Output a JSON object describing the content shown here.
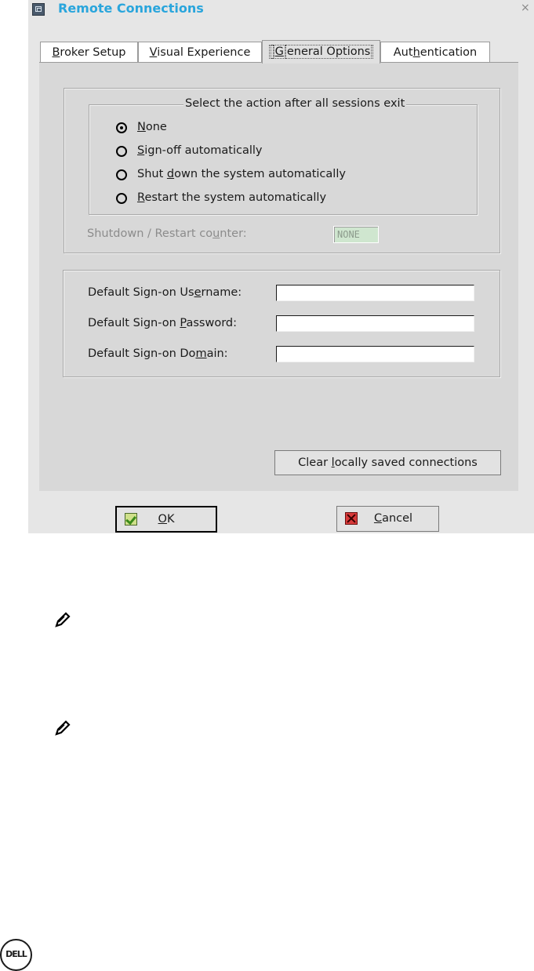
{
  "window": {
    "title": "Remote Connections",
    "close_glyph": "×"
  },
  "tabs": [
    {
      "pre": "",
      "accel": "B",
      "post": "roker Setup"
    },
    {
      "pre": "",
      "accel": "V",
      "post": "isual Experience"
    },
    {
      "pre": "",
      "accel": "G",
      "post": "eneral Options",
      "active": true
    },
    {
      "pre": "Aut",
      "accel": "h",
      "post": "entication"
    }
  ],
  "session_exit": {
    "legend": "Select the action after all sessions exit",
    "options": [
      {
        "pre": "",
        "accel": "N",
        "post": "one",
        "checked": true
      },
      {
        "pre": "",
        "accel": "S",
        "post": "ign-off automatically",
        "checked": false
      },
      {
        "pre": "Shut ",
        "accel": "d",
        "post": "own the system automatically",
        "checked": false
      },
      {
        "pre": "",
        "accel": "R",
        "post": "estart the system automatically",
        "checked": false
      }
    ],
    "counter_label_pre": "Shutdown / Restart co",
    "counter_label_accel": "u",
    "counter_label_post": "nter:",
    "counter_value": "NONE"
  },
  "sign_on": {
    "username": {
      "pre": "Default Sign-on Us",
      "accel": "e",
      "post": "rname:",
      "value": ""
    },
    "password": {
      "pre": "Default Sign-on ",
      "accel": "P",
      "post": "assword:",
      "value": ""
    },
    "domain": {
      "pre": "Default Sign-on Do",
      "accel": "m",
      "post": "ain:",
      "value": ""
    }
  },
  "clear_button": {
    "pre": "Clear ",
    "accel": "l",
    "post": "ocally saved connections"
  },
  "ok_button": {
    "pre": "",
    "accel": "O",
    "post": "K"
  },
  "cancel_button": {
    "pre": "",
    "accel": "C",
    "post": "ancel"
  },
  "logo_text": "DELL",
  "icons": {
    "app": "remote-connections-icon",
    "close": "close-icon",
    "ok": "checkmark-icon",
    "cancel": "x-icon",
    "note": "pencil-note-icon"
  },
  "colors": {
    "title": "#29a5dc",
    "panel": "#d8d8d8",
    "dialog": "#e6e6e6",
    "counter_bg": "#cfe6cf"
  }
}
